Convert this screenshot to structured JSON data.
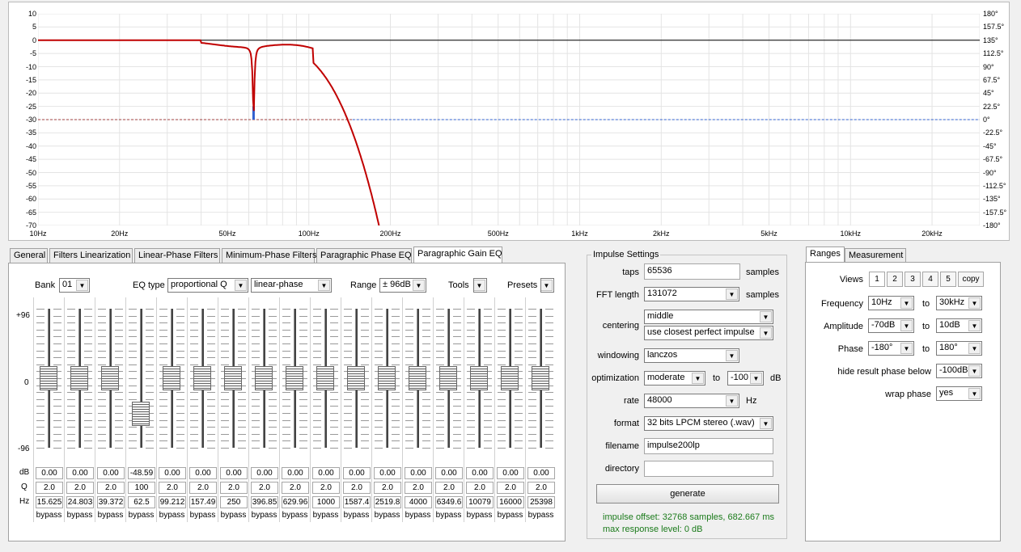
{
  "plot": {
    "y_ticks": [
      "10",
      "5",
      "0",
      "-5",
      "-10",
      "-15",
      "-20",
      "-25",
      "-30",
      "-35",
      "-40",
      "-45",
      "-50",
      "-55",
      "-60",
      "-65",
      "-70"
    ],
    "phase_ticks": [
      "180°",
      "157.5°",
      "135°",
      "112.5°",
      "90°",
      "67.5°",
      "45°",
      "22.5°",
      "0°",
      "-22.5°",
      "-45°",
      "-67.5°",
      "-90°",
      "-112.5°",
      "-135°",
      "-157.5°",
      "-180°"
    ],
    "x_ticks": [
      "10Hz",
      "20Hz",
      "50Hz",
      "100Hz",
      "200Hz",
      "500Hz",
      "1kHz",
      "2kHz",
      "5kHz",
      "10kHz",
      "20kHz"
    ],
    "colors": {
      "response": "#c00000",
      "phase": "#3060d0",
      "grid": "#e4e4e4",
      "zero": "#000000"
    }
  },
  "tabs": [
    "General",
    "Filters Linearization",
    "Linear-Phase Filters",
    "Minimum-Phase Filters",
    "Paragraphic Phase EQ",
    "Paragraphic Gain EQ"
  ],
  "eq": {
    "bank_label": "Bank",
    "bank": "01",
    "eqtype_label": "EQ type",
    "eqtype": "proportional Q",
    "phase_mode": "linear-phase",
    "range_label": "Range",
    "range": "± 96dB",
    "tools_label": "Tools",
    "presets_label": "Presets",
    "scale_top": "+96",
    "scale_mid": "0",
    "scale_bot": "-96",
    "row_db": "dB",
    "row_q": "Q",
    "row_hz": "Hz",
    "channels": [
      {
        "db": "0.00",
        "q": "2.0",
        "hz": "15.625",
        "state": "bypass"
      },
      {
        "db": "0.00",
        "q": "2.0",
        "hz": "24.803",
        "state": "bypass"
      },
      {
        "db": "0.00",
        "q": "2.0",
        "hz": "39.372",
        "state": "bypass"
      },
      {
        "db": "-48.59",
        "q": "100",
        "hz": "62.5",
        "state": "bypass"
      },
      {
        "db": "0.00",
        "q": "2.0",
        "hz": "99.212",
        "state": "bypass"
      },
      {
        "db": "0.00",
        "q": "2.0",
        "hz": "157.49",
        "state": "bypass"
      },
      {
        "db": "0.00",
        "q": "2.0",
        "hz": "250",
        "state": "bypass"
      },
      {
        "db": "0.00",
        "q": "2.0",
        "hz": "396.85",
        "state": "bypass"
      },
      {
        "db": "0.00",
        "q": "2.0",
        "hz": "629.96",
        "state": "bypass"
      },
      {
        "db": "0.00",
        "q": "2.0",
        "hz": "1000",
        "state": "bypass"
      },
      {
        "db": "0.00",
        "q": "2.0",
        "hz": "1587.4",
        "state": "bypass"
      },
      {
        "db": "0.00",
        "q": "2.0",
        "hz": "2519.8",
        "state": "bypass"
      },
      {
        "db": "0.00",
        "q": "2.0",
        "hz": "4000",
        "state": "bypass"
      },
      {
        "db": "0.00",
        "q": "2.0",
        "hz": "6349.6",
        "state": "bypass"
      },
      {
        "db": "0.00",
        "q": "2.0",
        "hz": "10079",
        "state": "bypass"
      },
      {
        "db": "0.00",
        "q": "2.0",
        "hz": "16000",
        "state": "bypass"
      },
      {
        "db": "0.00",
        "q": "2.0",
        "hz": "25398",
        "state": "bypass"
      }
    ]
  },
  "impulse": {
    "title": "Impulse Settings",
    "taps_label": "taps",
    "taps": "65536",
    "samples": "samples",
    "fft_label": "FFT length",
    "fft": "131072",
    "centering_label": "centering",
    "centering": "middle",
    "centering2": "use closest perfect impulse",
    "windowing_label": "windowing",
    "windowing": "lanczos",
    "optimization_label": "optimization",
    "optimization": "moderate",
    "to": "to",
    "opt_level": "-100",
    "db": "dB",
    "rate_label": "rate",
    "rate": "48000",
    "hz": "Hz",
    "format_label": "format",
    "format": "32 bits LPCM stereo (.wav)",
    "filename_label": "filename",
    "filename": "impulse200lp",
    "directory_label": "directory",
    "directory": "",
    "generate": "generate",
    "status1": "impulse offset: 32768 samples, 682.667 ms",
    "status2": "max response level: 0 dB",
    "status_color": "#1a7a1a"
  },
  "ranges": {
    "tabs": [
      "Ranges",
      "Measurement"
    ],
    "views_label": "Views",
    "views": [
      "1",
      "2",
      "3",
      "4",
      "5"
    ],
    "copy": "copy",
    "frequency_label": "Frequency",
    "freq_from": "10Hz",
    "freq_to": "30kHz",
    "amplitude_label": "Amplitude",
    "amp_from": "-70dB",
    "amp_to": "10dB",
    "phase_label": "Phase",
    "phase_from": "-180°",
    "phase_to": "180°",
    "hide_label": "hide result phase below",
    "hide": "-100dB",
    "wrap_label": "wrap phase",
    "wrap": "yes",
    "to": "to"
  }
}
